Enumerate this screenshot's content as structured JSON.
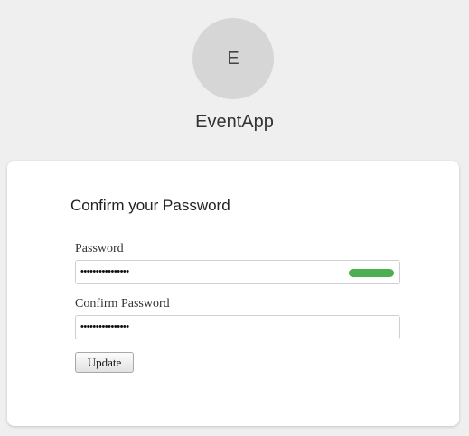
{
  "app": {
    "avatar_letter": "E",
    "name": "EventApp"
  },
  "form": {
    "title": "Confirm your Password",
    "password": {
      "label": "Password",
      "value_masked": "••••••••••••••••",
      "strength_color": "#4caf50",
      "strength_indicator": "strong"
    },
    "confirm_password": {
      "label": "Confirm Password",
      "value_masked": "••••••••••••••••"
    },
    "update_label": "Update"
  }
}
